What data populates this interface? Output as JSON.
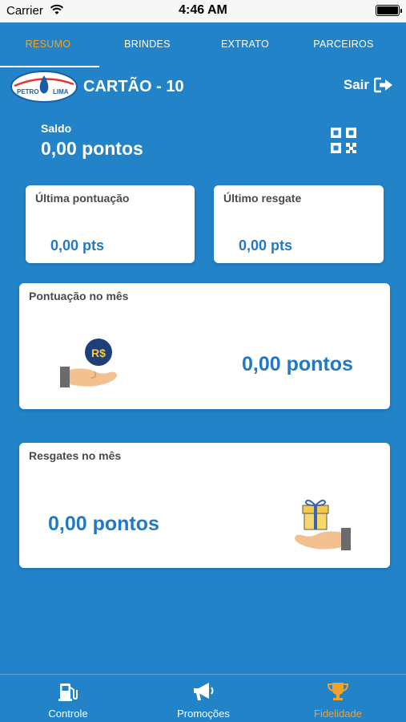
{
  "status_bar": {
    "carrier": "Carrier",
    "time": "4:46 AM"
  },
  "tabs": [
    {
      "label": "RESUMO",
      "active": true
    },
    {
      "label": "BRINDES",
      "active": false
    },
    {
      "label": "EXTRATO",
      "active": false
    },
    {
      "label": "PARCEIROS",
      "active": false
    }
  ],
  "header": {
    "logo_text_left": "PETRO",
    "logo_text_right": "LIMA",
    "card_title": "CARTÃO - 10",
    "logout_label": "Sair"
  },
  "balance": {
    "label": "Saldo",
    "value": "0,00 pontos"
  },
  "summary": {
    "last_points": {
      "label": "Última pontuação",
      "value": "0,00 pts"
    },
    "last_redeem": {
      "label": "Último resgate",
      "value": "0,00 pts"
    }
  },
  "monthly_points": {
    "label": "Pontuação no mês",
    "value": "0,00 pontos",
    "icon": "hand-money-icon",
    "coin_text": "R$"
  },
  "monthly_redeems": {
    "label": "Resgates no mês",
    "value": "0,00 pontos",
    "icon": "hand-gift-icon"
  },
  "bottom_nav": [
    {
      "label": "Controle",
      "icon": "fuel-pump-icon",
      "active": false
    },
    {
      "label": "Promoções",
      "icon": "megaphone-icon",
      "active": false
    },
    {
      "label": "Fidelidade",
      "icon": "trophy-icon",
      "active": true
    }
  ],
  "colors": {
    "background": "#2283c9",
    "accent": "#f0a22a",
    "value_blue": "#2378c4",
    "card_label": "#4a4a4a"
  }
}
